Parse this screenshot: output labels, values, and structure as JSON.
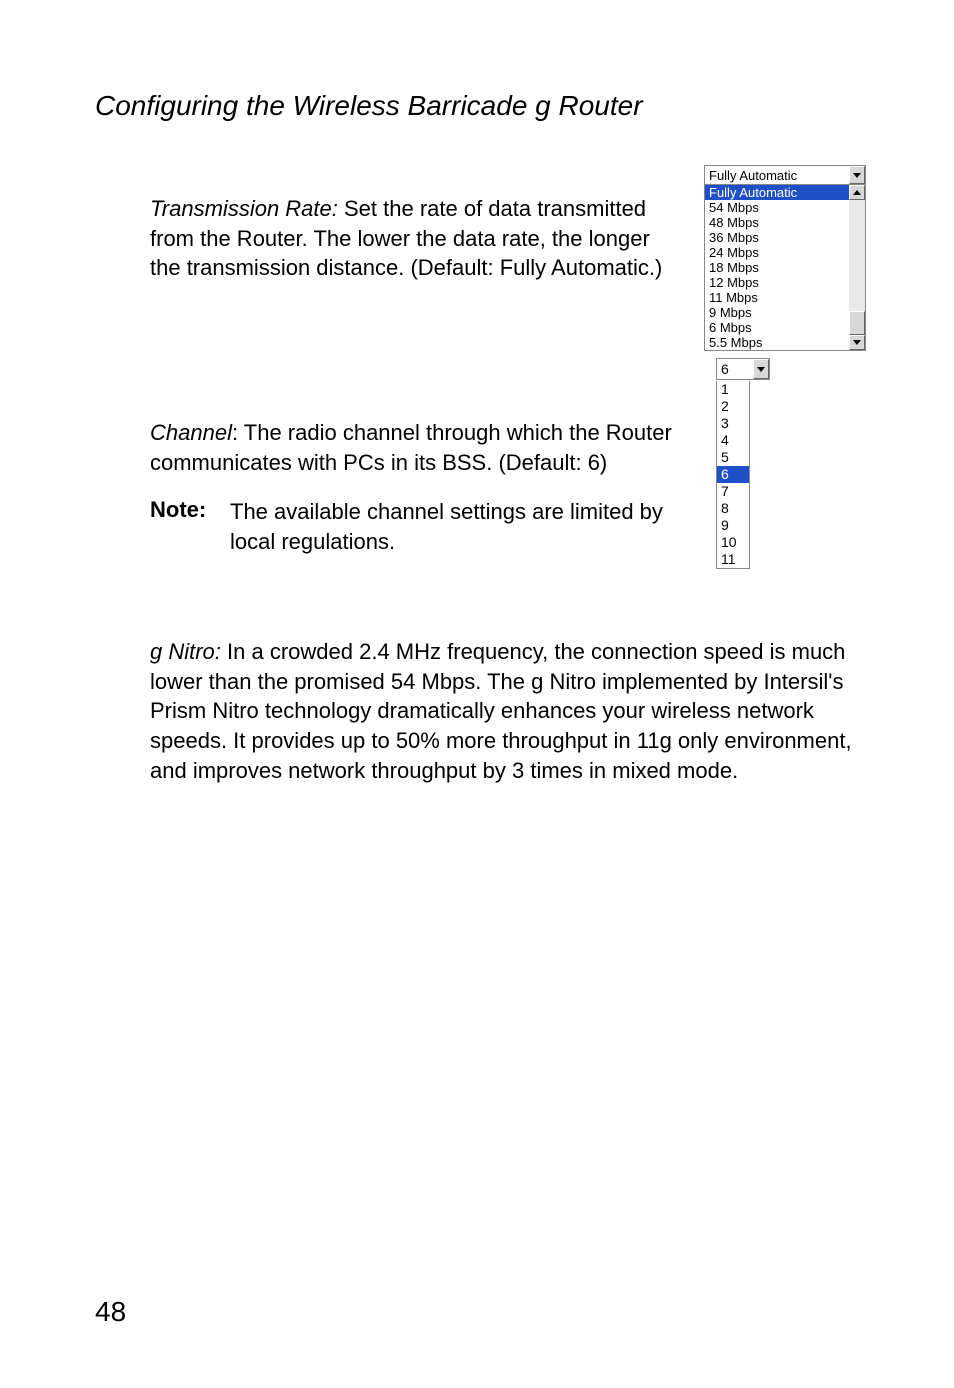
{
  "page_title": "Configuring the Wireless Barricade g Router",
  "transmission_rate": {
    "label": "Transmission Rate:",
    "desc": " Set the rate of data transmitted from the Router. The lower the data rate, the longer the transmission distance. (Default: Fully Automatic.)"
  },
  "channel": {
    "label": "Channel",
    "desc": ": The radio channel through which the Router communicates with PCs in its BSS. (Default: 6)"
  },
  "note": {
    "label": "Note:",
    "text": "The available channel settings are limited by local regulations."
  },
  "gnitro": {
    "label": "g Nitro:",
    "desc": " In a crowded 2.4 MHz frequency, the connection speed is much lower than the promised 54 Mbps. The g Nitro implemented by Intersil's Prism Nitro technology dramatically enhances your wireless network speeds. It provides up to 50% more throughput in 11g only environment, and improves network throughput by 3 times in mixed mode."
  },
  "rate_dropdown": {
    "selected": "Fully Automatic",
    "options": [
      "Fully Automatic",
      "54 Mbps",
      "48 Mbps",
      "36 Mbps",
      "24 Mbps",
      "18 Mbps",
      "12 Mbps",
      "11 Mbps",
      "9 Mbps",
      "6 Mbps",
      "5.5 Mbps"
    ],
    "selected_index": 0
  },
  "channel_dropdown": {
    "selected": "6",
    "options": [
      "1",
      "2",
      "3",
      "4",
      "5",
      "6",
      "7",
      "8",
      "9",
      "10",
      "11"
    ],
    "selected_index": 5
  },
  "page_number": "48"
}
